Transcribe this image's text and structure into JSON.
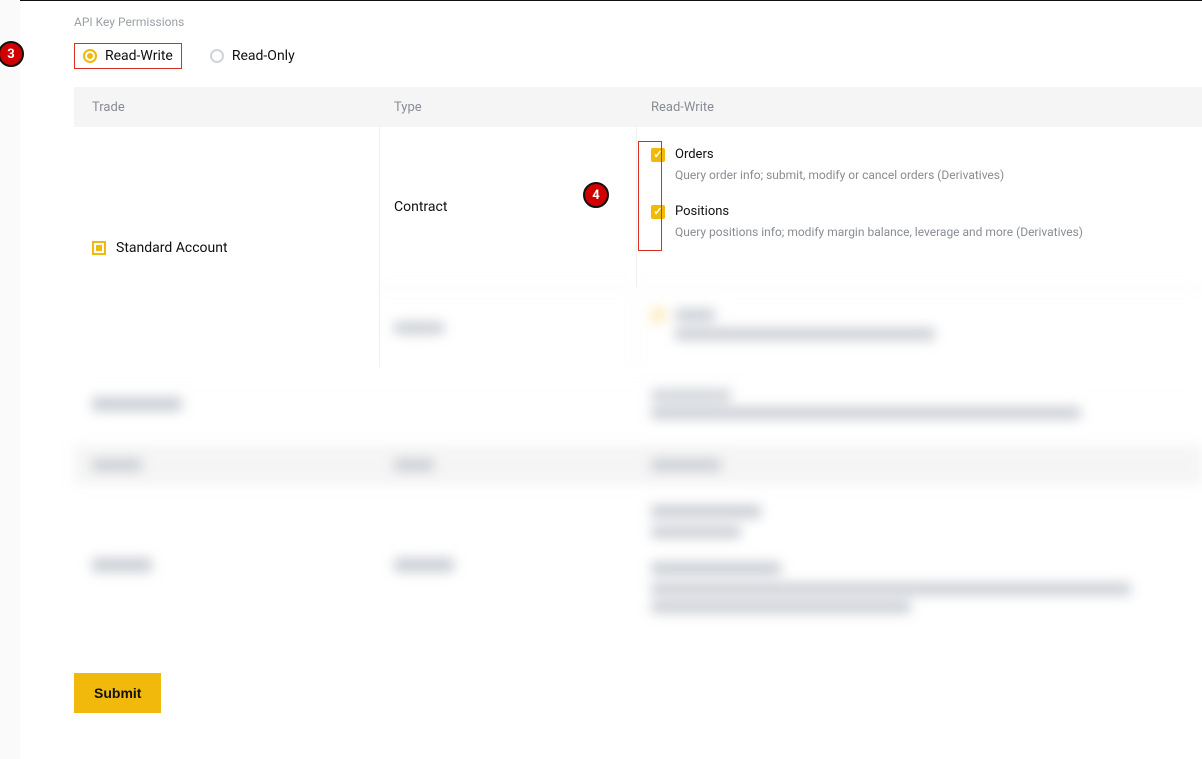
{
  "section_label": "API Key Permissions",
  "radios": {
    "read_write": "Read-Write",
    "read_only": "Read-Only"
  },
  "columns": {
    "trade": "Trade",
    "type": "Type",
    "perm": "Read-Write"
  },
  "row1": {
    "trade_label": "Standard Account",
    "type_label": "Contract",
    "orders": {
      "title": "Orders",
      "desc": "Query order info; submit, modify or cancel orders (Derivatives)"
    },
    "positions": {
      "title": "Positions",
      "desc": "Query positions info; modify margin balance, leverage and more (Derivatives)"
    }
  },
  "annotations": {
    "three": "3",
    "four": "4"
  },
  "submit": "Submit"
}
